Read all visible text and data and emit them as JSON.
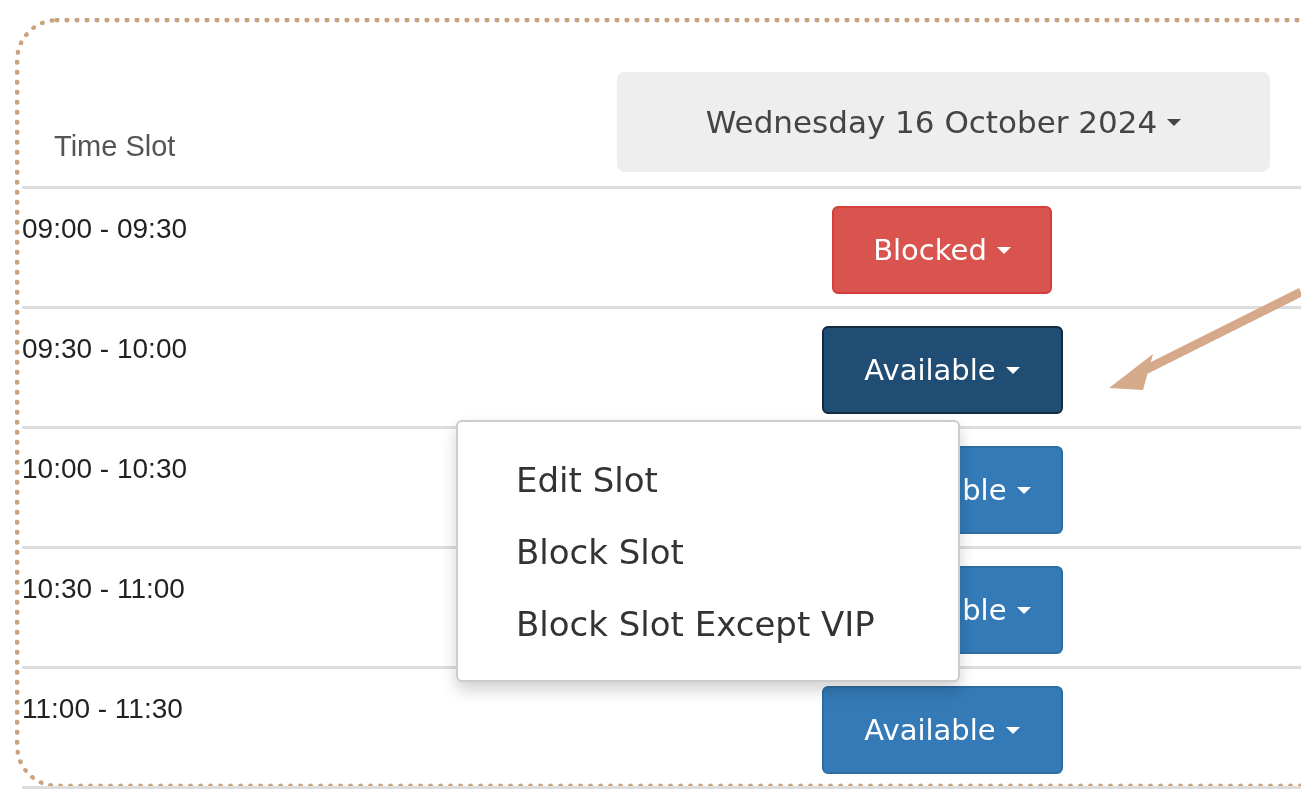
{
  "header": {
    "column_label": "Time Slot",
    "date_button": "Wednesday 16 October 2024"
  },
  "rows": [
    {
      "time": "09:00 - 09:30",
      "status": {
        "kind": "blocked",
        "label": "Blocked",
        "open": false
      }
    },
    {
      "time": "09:30 - 10:00",
      "status": {
        "kind": "available",
        "label": "Available",
        "open": true
      }
    },
    {
      "time": "10:00 - 10:30",
      "status": {
        "kind": "available",
        "label": "ble",
        "open": false
      }
    },
    {
      "time": "10:30 - 11:00",
      "status": {
        "kind": "available",
        "label": "ble",
        "open": false
      }
    },
    {
      "time": "11:00 - 11:30",
      "status": {
        "kind": "available",
        "label": "Available",
        "open": false
      }
    }
  ],
  "dropdown_menu": {
    "items": [
      "Edit Slot",
      "Block Slot",
      "Block Slot Except VIP"
    ]
  }
}
